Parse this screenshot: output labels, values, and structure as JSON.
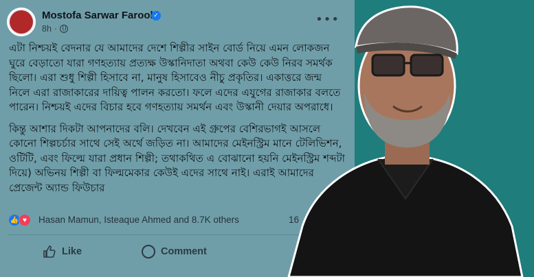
{
  "post": {
    "author": "Mostofa Sarwar Farooki",
    "time": "8h",
    "more": "•••",
    "paragraphs": [
      "এটা নিশ্চয়ই বেদনার যে আমাদের দেশে শিল্পীর সাইন বোর্ড নিয়ে এমন লোকজন ঘুরে বেড়াতো যারা গণহত্যায় প্রত্যক্ষ উস্কানিদাতা অথবা কেউ কেউ নিরব সমর্থক ছিলো। এরা শুধু শিল্পী হিসাবে না, মানুষ হিসাবেও নীচু প্রকৃতির। একাত্তরে জন্ম নিলে এরা রাজাকারের দায়িত্ব পালন করতো। ফলে এদের এযুগের রাজাকার বলতে পারেন। নিশ্চয়ই এদের বিচার হবে গণহত্যায় সমর্থন এবং উস্কানী দেয়ার অপরাধে।",
      "কিন্তু আশার দিকটা আপনাদের বলি। দেখবেন এই গ্রুপের বেশিরভাগই আসলে কোনো শিল্পচর্চার সাথে সেই অর্থে জড়িত না। আমাদের মেইনস্ট্রিম মানে টেলিভিশন, ওটিটি, এবং ফিল্মে যারা প্রধান শিল্পী; তথাকথিত এ বোঝানো হয়নি মেইনস্ট্রিম শব্দটা দিয়ে) অভিনয় শিল্পী বা ফিল্মমেকার কেউই এদের সাথে নাই। এরাই আমাদের প্রেজেন্ট অ্যান্ড ফিউচার"
    ],
    "reactors": "Hasan Mamun, Isteaque Ahmed and 8.7K others",
    "comment_count": "16",
    "actions": {
      "like": "Like",
      "comment": "Comment"
    }
  },
  "colors": {
    "post_bg": "#6f9ea9",
    "page_bg": "#1f7d7c",
    "like_blue": "#1877f2",
    "love_red": "#f33e58"
  },
  "icons": [
    "verified-badge-icon",
    "globe-icon",
    "more-options-icon",
    "like-reaction-icon",
    "love-reaction-icon",
    "thumbs-up-icon",
    "comment-bubble-icon"
  ]
}
